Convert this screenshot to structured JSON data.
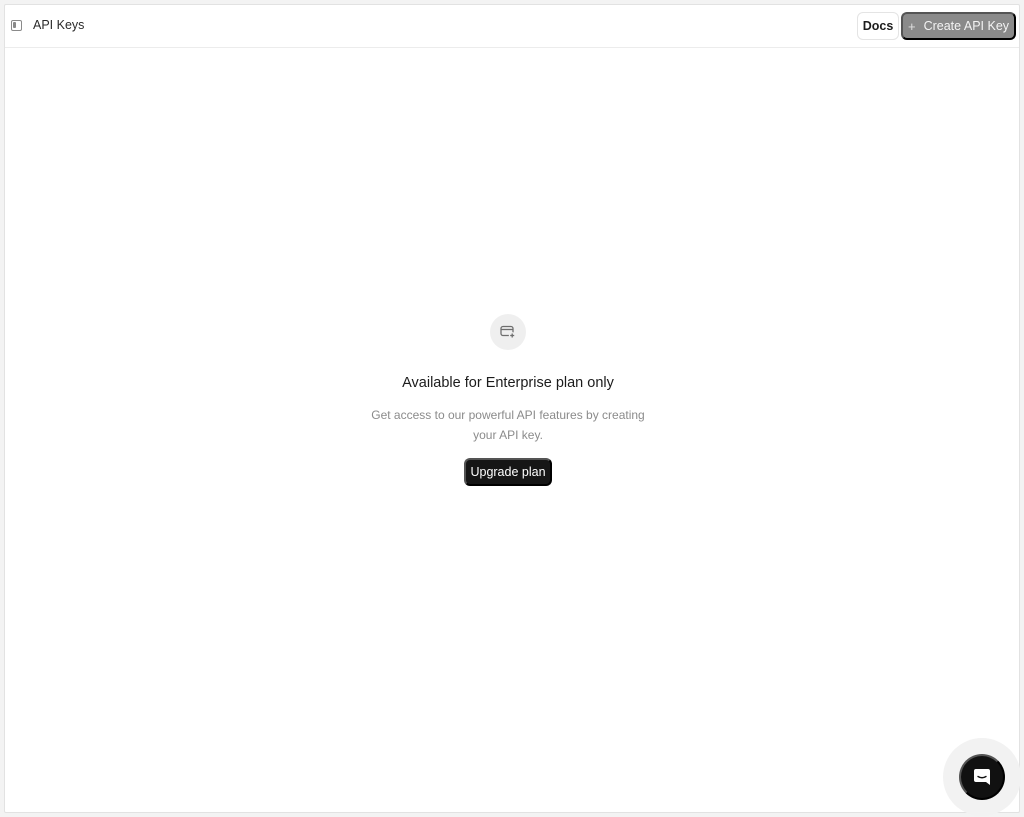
{
  "header": {
    "title": "API Keys",
    "docs_label": "Docs",
    "create_label": "Create API Key",
    "create_icon": "plus-icon",
    "toggle_icon": "sidebar-toggle-icon"
  },
  "empty_state": {
    "icon": "card-add-icon",
    "title": "Available for Enterprise plan only",
    "description": "Get access to our powerful API features by creating your API key.",
    "button_label": "Upgrade plan"
  },
  "chat_widget": {
    "icon": "chat-icon"
  },
  "colors": {
    "primary_button": "#161616",
    "disabled_button": "#8a8a8a",
    "muted_text": "#8b8b8b"
  }
}
